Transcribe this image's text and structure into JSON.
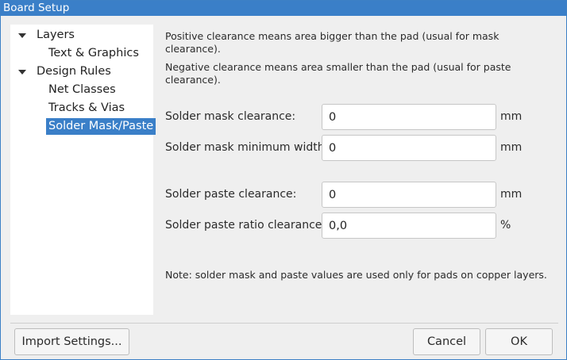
{
  "window": {
    "title": "Board Setup"
  },
  "tree": {
    "items": [
      {
        "label": "Layers",
        "expanded": true
      },
      {
        "label": "Text & Graphics"
      },
      {
        "label": "Design Rules",
        "expanded": true
      },
      {
        "label": "Net Classes"
      },
      {
        "label": "Tracks & Vias"
      },
      {
        "label": "Solder Mask/Paste",
        "selected": true
      }
    ]
  },
  "panel": {
    "info_line1": "Positive clearance means area bigger than the pad (usual for mask",
    "info_line2": "clearance).",
    "info_line3": "Negative clearance means area smaller than the pad (usual for paste",
    "info_line4": "clearance).",
    "mask_clearance": {
      "label": "Solder mask clearance:",
      "value": "0",
      "unit": "mm"
    },
    "mask_min_width": {
      "label": "Solder mask minimum width:",
      "value": "0",
      "unit": "mm"
    },
    "paste_clearance": {
      "label": "Solder paste clearance:",
      "value": "0",
      "unit": "mm"
    },
    "paste_ratio": {
      "label": "Solder paste ratio clearance:",
      "value": "0,0",
      "unit": "%"
    },
    "note": "Note: solder mask and paste values are used only for pads on copper layers."
  },
  "buttons": {
    "import": "Import Settings...",
    "cancel": "Cancel",
    "ok": "OK"
  },
  "colors": {
    "accent": "#3a7fc8",
    "panel_bg": "#efefef"
  }
}
